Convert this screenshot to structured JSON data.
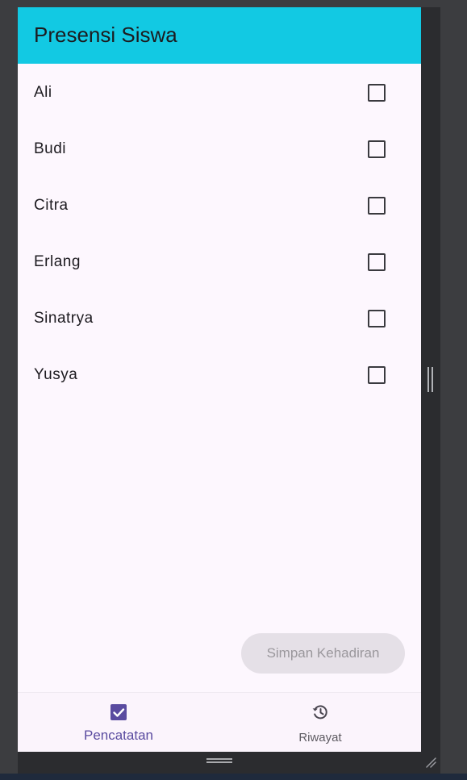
{
  "app": {
    "title": "Presensi Siswa"
  },
  "students": [
    {
      "name": "Ali",
      "checked": false
    },
    {
      "name": "Budi",
      "checked": false
    },
    {
      "name": "Citra",
      "checked": false
    },
    {
      "name": "Erlang",
      "checked": false
    },
    {
      "name": "Sinatrya",
      "checked": false
    },
    {
      "name": "Yusya",
      "checked": false
    }
  ],
  "actions": {
    "save_label": "Simpan Kehadiran",
    "save_enabled": false
  },
  "bottom_nav": {
    "items": [
      {
        "label": "Pencatatan",
        "icon": "check-box-icon",
        "active": true
      },
      {
        "label": "Riwayat",
        "icon": "history-icon",
        "active": false
      }
    ]
  },
  "colors": {
    "appbar": "#12c9e3",
    "background": "#fdf7fe",
    "accent": "#5a4ba0"
  }
}
